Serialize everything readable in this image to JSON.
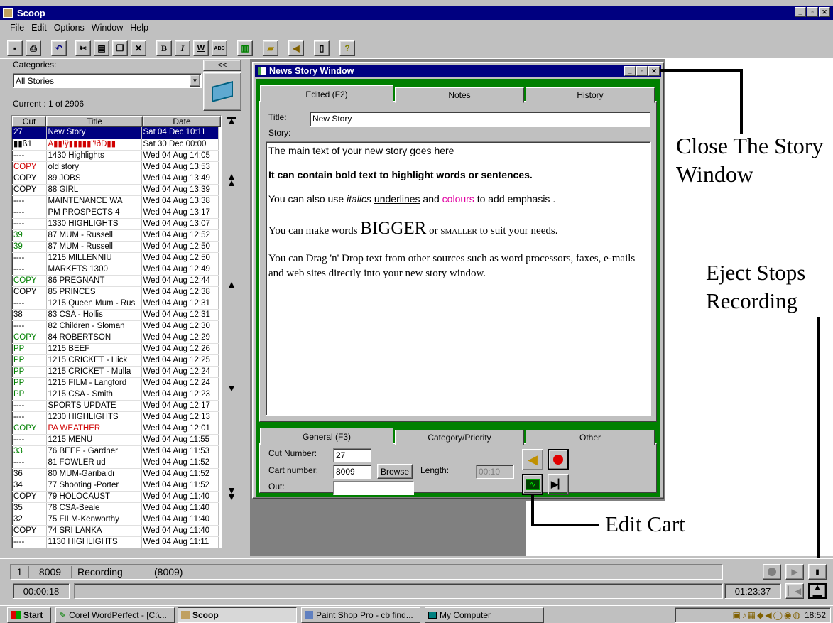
{
  "app": {
    "title": "Scoop"
  },
  "menu": [
    "File",
    "Edit",
    "Options",
    "Window",
    "Help"
  ],
  "toolbar": {
    "bold": "B",
    "italic": "I",
    "word": "W",
    "abc": "ABC",
    "help": "?"
  },
  "left_panel": {
    "categories_label": "Categories:",
    "collapse_label": "<<",
    "category_value": "All Stories",
    "current_text": "Current : 1 of 2906",
    "columns": [
      "Cut",
      "Title",
      "Date"
    ],
    "rows": [
      {
        "cut": "27",
        "title": "New Story",
        "date": "Sat 04 Dec 10:11",
        "selected": true
      },
      {
        "cut": "▮▮ß1",
        "title": "A▮▮!ÿ▮▮▮▮▮\"!ðÐ▮▮",
        "date": "Sat 30 Dec 00:00",
        "title_color": "#d00000"
      },
      {
        "cut": "----",
        "title": "1430 Highlights",
        "date": "Wed 04 Aug 14:05"
      },
      {
        "cut": "COPY",
        "title": "old story",
        "date": "Wed 04 Aug 13:53",
        "cut_color": "#d00000"
      },
      {
        "cut": "COPY",
        "title": "89 JOBS",
        "date": "Wed 04 Aug 13:49"
      },
      {
        "cut": "COPY",
        "title": "88 GIRL",
        "date": "Wed 04 Aug 13:39"
      },
      {
        "cut": "----",
        "title": "MAINTENANCE WA",
        "date": "Wed 04 Aug 13:38"
      },
      {
        "cut": "----",
        "title": "PM PROSPECTS 4",
        "date": "Wed 04 Aug 13:17"
      },
      {
        "cut": "----",
        "title": "1330 HIGHLIGHTS",
        "date": "Wed 04 Aug 13:07"
      },
      {
        "cut": "39",
        "title": "87 MUM - Russell",
        "date": "Wed 04 Aug 12:52",
        "cut_color": "#008000"
      },
      {
        "cut": "39",
        "title": "87 MUM - Russell",
        "date": "Wed 04 Aug 12:50",
        "cut_color": "#008000"
      },
      {
        "cut": "----",
        "title": "1215 MILLENNIU",
        "date": "Wed 04 Aug 12:50"
      },
      {
        "cut": "----",
        "title": "MARKETS 1300",
        "date": "Wed 04 Aug 12:49"
      },
      {
        "cut": "COPY",
        "title": "86 PREGNANT",
        "date": "Wed 04 Aug 12:44",
        "cut_color": "#008000"
      },
      {
        "cut": "COPY",
        "title": "85 PRINCES",
        "date": "Wed 04 Aug 12:38"
      },
      {
        "cut": "----",
        "title": "1215 Queen Mum - Rus",
        "date": "Wed 04 Aug 12:31"
      },
      {
        "cut": "38",
        "title": "83 CSA - Hollis",
        "date": "Wed 04 Aug 12:31"
      },
      {
        "cut": "----",
        "title": "82 Children - Sloman",
        "date": "Wed 04 Aug 12:30"
      },
      {
        "cut": "COPY",
        "title": "84 ROBERTSON",
        "date": "Wed 04 Aug 12:29",
        "cut_color": "#008000"
      },
      {
        "cut": "PP",
        "title": "1215 BEEF",
        "date": "Wed 04 Aug 12:26",
        "cut_color": "#008000"
      },
      {
        "cut": "PP",
        "title": "1215 CRICKET - Hick",
        "date": "Wed 04 Aug 12:25",
        "cut_color": "#008000"
      },
      {
        "cut": "PP",
        "title": "1215 CRICKET - Mulla",
        "date": "Wed 04 Aug 12:24",
        "cut_color": "#008000"
      },
      {
        "cut": "PP",
        "title": "1215 FILM - Langford",
        "date": "Wed 04 Aug 12:24",
        "cut_color": "#008000"
      },
      {
        "cut": "PP",
        "title": "1215 CSA - Smith",
        "date": "Wed 04 Aug 12:23",
        "cut_color": "#008000"
      },
      {
        "cut": "----",
        "title": "SPORTS UPDATE",
        "date": "Wed 04 Aug 12:17"
      },
      {
        "cut": "----",
        "title": "1230 HIGHLIGHTS",
        "date": "Wed 04 Aug 12:13"
      },
      {
        "cut": "COPY",
        "title": "PA WEATHER",
        "date": "Wed 04 Aug 12:01",
        "cut_color": "#008000",
        "title_color": "#d00000"
      },
      {
        "cut": "----",
        "title": "1215 MENU",
        "date": "Wed 04 Aug 11:55"
      },
      {
        "cut": "33",
        "title": "76 BEEF - Gardner",
        "date": "Wed 04 Aug 11:53",
        "cut_color": "#008000"
      },
      {
        "cut": "----",
        "title": "81 FOWLER ud",
        "date": "Wed 04 Aug 11:52"
      },
      {
        "cut": "36",
        "title": "80 MUM-Garibaldi",
        "date": "Wed 04 Aug 11:52"
      },
      {
        "cut": "34",
        "title": "77 Shooting -Porter",
        "date": "Wed 04 Aug 11:52"
      },
      {
        "cut": "COPY",
        "title": "79 HOLOCAUST",
        "date": "Wed 04 Aug 11:40"
      },
      {
        "cut": "35",
        "title": "78 CSA-Beale",
        "date": "Wed 04 Aug 11:40"
      },
      {
        "cut": "32",
        "title": "75 FILM-Kenworthy",
        "date": "Wed 04 Aug 11:40"
      },
      {
        "cut": "COPY",
        "title": "74 SRI LANKA",
        "date": "Wed 04 Aug 11:40"
      },
      {
        "cut": "----",
        "title": "1130 HIGHLIGHTS",
        "date": "Wed 04 Aug 11:11"
      }
    ]
  },
  "story_window": {
    "title": "News Story Window",
    "tabs_top": [
      "Edited (F2)",
      "Notes",
      "History"
    ],
    "title_label": "Title:",
    "title_value": "New Story",
    "story_label": "Story:",
    "story": {
      "p1": "The main text of your new story goes here",
      "p2": "It can contain bold text to highlight words or sentences.",
      "p3_a": "You can also use ",
      "p3_italics": "italics",
      "p3_b": " ",
      "p3_underlines": "underlines",
      "p3_c": " and ",
      "p3_colours": "colours",
      "p3_d": " to add emphasis .",
      "p4_a": "You can make words ",
      "p4_bigger": "BIGGER",
      "p4_b": " or ",
      "p4_smaller": "SMALLER",
      "p4_c": " to suit your needs.",
      "p5": "You can Drag 'n' Drop text from other sources such as word processors, faxes, e-mails and web sites directly into your new story window."
    },
    "tabs_bottom": [
      "General (F3)",
      "Category/Priority",
      "Other"
    ],
    "cut_number_label": "Cut Number:",
    "cut_number": "27",
    "cart_number_label": "Cart number:",
    "cart_number": "8009",
    "browse_label": "Browse",
    "length_label": "Length:",
    "length_value": "00:10",
    "out_label": "Out:",
    "out_value": ""
  },
  "annotations": {
    "close_story": "Close The Story Window",
    "eject": "Eject Stops Recording",
    "edit_cart": "Edit Cart"
  },
  "status": {
    "channel": "1",
    "cart": "8009",
    "state": "Recording",
    "cart_paren": "(8009)",
    "elapsed": "00:00:18",
    "total": "01:23:37"
  },
  "taskbar": {
    "start": "Start",
    "items": [
      "Corel WordPerfect - [C:\\...",
      "Scoop",
      "Paint Shop Pro - cb find...",
      "My Computer"
    ],
    "clock": "18:52"
  },
  "colors": {
    "accent_green": "#008000",
    "selection": "#000080",
    "magenta": "#e000a0"
  }
}
